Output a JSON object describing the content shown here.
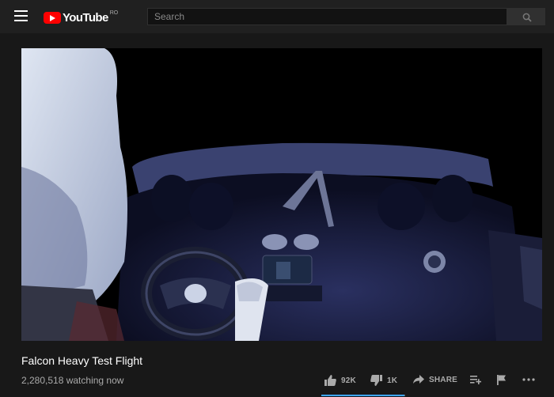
{
  "masthead": {
    "logo_text": "YouTube",
    "country_code": "RO",
    "search_placeholder": "Search"
  },
  "video": {
    "title": "Falcon Heavy Test Flight",
    "views": "2,280,518 watching now",
    "likes": "92K",
    "dislikes": "1K",
    "share_label": "SHARE",
    "like_ratio": 0.989
  },
  "icons": {
    "menu": "menu-icon",
    "logo": "youtube-logo-icon",
    "search": "search-icon",
    "like": "thumbs-up-icon",
    "dislike": "thumbs-down-icon",
    "share": "share-icon",
    "save": "add-to-playlist-icon",
    "report": "flag-icon",
    "more": "more-icon"
  },
  "colors": {
    "brand_red": "#ff0000",
    "accent_blue": "#3ea6ff",
    "background": "#181818"
  }
}
